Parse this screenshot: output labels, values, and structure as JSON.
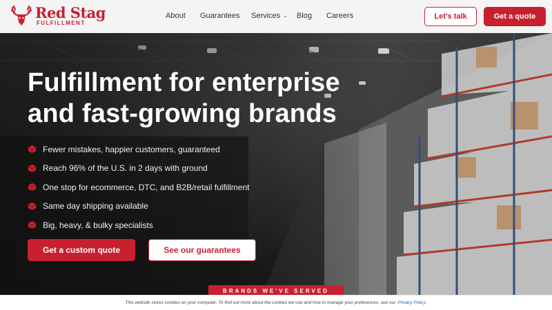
{
  "brand": {
    "name": "Red Stag",
    "sub": "FULFILLMENT",
    "color": "#c8202f"
  },
  "nav": {
    "items": [
      {
        "label": "About"
      },
      {
        "label": "Guarantees"
      },
      {
        "label": "Services"
      },
      {
        "label": "Blog"
      },
      {
        "label": "Careers"
      }
    ],
    "talk_label": "Let's talk",
    "quote_label": "Get a quote"
  },
  "hero": {
    "headline_line1": "Fulfillment for enterprise",
    "headline_line2": "and fast-growing brands",
    "bullets": [
      "Fewer mistakes, happier customers, guaranteed",
      "Reach 96% of the U.S. in 2 days with ground",
      "One stop for ecommerce, DTC, and B2B/retail fulfillment",
      "Same day shipping available",
      "Big, heavy, & bulky specialists"
    ],
    "cta_primary": "Get a custom quote",
    "cta_secondary": "See our guarantees",
    "brands_tag": "BRANDS WE'VE SERVED"
  },
  "cookie": {
    "text": "This website stores cookies on your computer. To find out more about the cookies we use and how to manage your preferences, see our",
    "link": "Privacy Policy",
    "end": "."
  },
  "icons": {
    "bullet": "cube-icon",
    "logo": "stag-head-icon",
    "dropdown": "chevron-down-icon"
  }
}
